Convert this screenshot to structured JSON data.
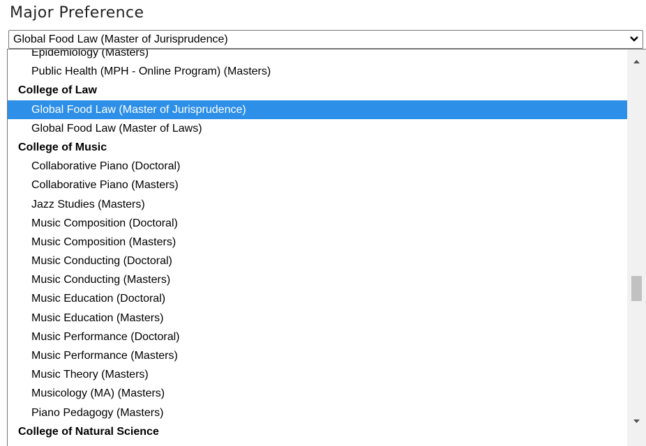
{
  "field": {
    "label": "Major Preference",
    "selected_value": "Global Food Law (Master of Jurisprudence)"
  },
  "dropdown": {
    "options": [
      {
        "type": "item",
        "label": "Epidemiology (Masters)"
      },
      {
        "type": "item",
        "label": "Public Health (MPH - Online Program) (Masters)"
      },
      {
        "type": "group",
        "label": "College of Law"
      },
      {
        "type": "item",
        "label": "Global Food Law (Master of Jurisprudence)",
        "selected": true
      },
      {
        "type": "item",
        "label": "Global Food Law (Master of Laws)"
      },
      {
        "type": "group",
        "label": "College of Music"
      },
      {
        "type": "item",
        "label": "Collaborative Piano (Doctoral)"
      },
      {
        "type": "item",
        "label": "Collaborative Piano (Masters)"
      },
      {
        "type": "item",
        "label": "Jazz Studies (Masters)"
      },
      {
        "type": "item",
        "label": "Music Composition (Doctoral)"
      },
      {
        "type": "item",
        "label": "Music Composition (Masters)"
      },
      {
        "type": "item",
        "label": "Music Conducting (Doctoral)"
      },
      {
        "type": "item",
        "label": "Music Conducting (Masters)"
      },
      {
        "type": "item",
        "label": "Music Education (Doctoral)"
      },
      {
        "type": "item",
        "label": "Music Education (Masters)"
      },
      {
        "type": "item",
        "label": "Music Performance (Doctoral)"
      },
      {
        "type": "item",
        "label": "Music Performance (Masters)"
      },
      {
        "type": "item",
        "label": "Music Theory (Masters)"
      },
      {
        "type": "item",
        "label": "Musicology (MA) (Masters)"
      },
      {
        "type": "item",
        "label": "Piano Pedagogy (Masters)"
      },
      {
        "type": "group",
        "label": "College of Natural Science"
      }
    ]
  },
  "colors": {
    "selected_bg": "#2d8fe8",
    "selected_text": "#ffffff",
    "scrollbar_track": "#f1f1f1",
    "scrollbar_thumb": "#c1c1c1"
  },
  "icons": {
    "select_arrow": "chevron-down-icon",
    "scroll_up": "triangle-up-icon",
    "scroll_down": "triangle-down-icon"
  }
}
